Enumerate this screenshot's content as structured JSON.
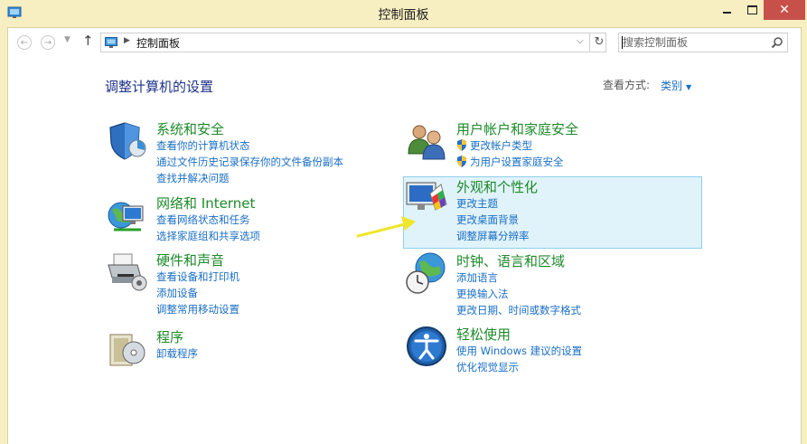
{
  "window": {
    "title": "控制面板"
  },
  "nav": {
    "address": "控制面板",
    "search_placeholder": "搜索控制面板"
  },
  "header": {
    "title": "调整计算机的设置",
    "view_label": "查看方式:",
    "view_value": "类别"
  },
  "categories": [
    {
      "title": "系统和安全",
      "icon": "shield-system-icon",
      "links": [
        "查看你的计算机状态",
        "通过文件历史记录保存你的文件备份副本",
        "查找并解决问题"
      ]
    },
    {
      "title": "网络和 Internet",
      "icon": "network-globe-icon",
      "links": [
        "查看网络状态和任务",
        "选择家庭组和共享选项"
      ]
    },
    {
      "title": "硬件和声音",
      "icon": "printer-icon",
      "links": [
        "查看设备和打印机",
        "添加设备",
        "调整常用移动设置"
      ]
    },
    {
      "title": "程序",
      "icon": "programs-icon",
      "links": [
        "卸载程序"
      ]
    },
    {
      "title": "用户帐户和家庭安全",
      "icon": "users-icon",
      "links": [
        "更改帐户类型",
        "为用户设置家庭安全"
      ]
    },
    {
      "title": "外观和个性化",
      "icon": "appearance-icon",
      "links": [
        "更改主题",
        "更改桌面背景",
        "调整屏幕分辨率"
      ]
    },
    {
      "title": "时钟、语言和区域",
      "icon": "clock-globe-icon",
      "links": [
        "添加语言",
        "更换输入法",
        "更改日期、时间或数字格式"
      ]
    },
    {
      "title": "轻松使用",
      "icon": "ease-of-access-icon",
      "links": [
        "使用 Windows 建议的设置",
        "优化视觉显示"
      ]
    }
  ],
  "colors": {
    "frame": "#f7eec1",
    "accent_link": "#1a6fc4",
    "category_title": "#1d8a2a",
    "highlight": "#e1f3fa",
    "close_button": "#c7504a"
  }
}
